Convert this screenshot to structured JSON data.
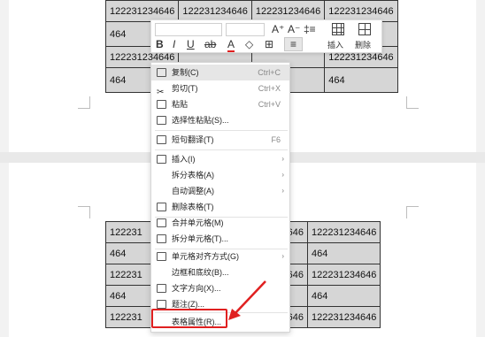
{
  "table_top": {
    "rows": [
      [
        "122231234646",
        "122231234646",
        "122231234646",
        "122231234646"
      ],
      [
        "464",
        "",
        "",
        "464"
      ],
      [
        "122231234646",
        "",
        "",
        "122231234646"
      ],
      [
        "464",
        "",
        "",
        "464"
      ]
    ]
  },
  "table_bottom": {
    "rows": [
      [
        "122231",
        "",
        "646",
        "122231234646"
      ],
      [
        "464",
        "",
        "",
        "464"
      ],
      [
        "122231",
        "",
        "646",
        "122231234646"
      ],
      [
        "464",
        "",
        "",
        "464"
      ],
      [
        "122231",
        "",
        "646",
        "122231234646"
      ]
    ]
  },
  "toolbar": {
    "font_size_up": "A⁺",
    "font_size_down": "A⁻",
    "line_spacing": "‡≡",
    "bold": "B",
    "italic": "I",
    "underline": "U",
    "highlight": "ab",
    "font_color": "A",
    "shading": "◇",
    "borders": "⊞",
    "align": "≡",
    "insert_label": "插入",
    "delete_label": "删除"
  },
  "menu": {
    "items": [
      {
        "label": "复制(C)",
        "shortcut": "Ctrl+C",
        "icon": "copy-icon"
      },
      {
        "label": "剪切(T)",
        "shortcut": "Ctrl+X",
        "icon": "scissors-icon"
      },
      {
        "label": "粘贴",
        "shortcut": "Ctrl+V",
        "icon": "paste-icon"
      },
      {
        "label": "选择性粘贴(S)...",
        "shortcut": "",
        "icon": "paste-special-icon"
      },
      {
        "label": "短句翻译(T)",
        "shortcut": "F6",
        "icon": "translate-icon"
      },
      {
        "label": "插入(I)",
        "shortcut": "",
        "icon": "insert-table-icon"
      },
      {
        "label": "拆分表格(A)",
        "shortcut": "",
        "icon": ""
      },
      {
        "label": "自动调整(A)",
        "shortcut": "",
        "icon": ""
      },
      {
        "label": "删除表格(T)",
        "shortcut": "",
        "icon": "delete-table-icon"
      },
      {
        "label": "合并单元格(M)",
        "shortcut": "",
        "icon": "merge-cells-icon"
      },
      {
        "label": "拆分单元格(T)...",
        "shortcut": "",
        "icon": "split-cells-icon"
      },
      {
        "label": "单元格对齐方式(G)",
        "shortcut": "",
        "icon": "cell-align-icon"
      },
      {
        "label": "边框和底纹(B)...",
        "shortcut": "",
        "icon": ""
      },
      {
        "label": "文字方向(X)...",
        "shortcut": "",
        "icon": "text-direction-icon"
      },
      {
        "label": "题注(Z)...",
        "shortcut": "",
        "icon": "caption-icon"
      },
      {
        "label": "表格属性(R)...",
        "shortcut": "",
        "icon": ""
      }
    ]
  },
  "colors": {
    "highlight_box": "#e02020",
    "cell_bg": "#d6d6d6"
  }
}
